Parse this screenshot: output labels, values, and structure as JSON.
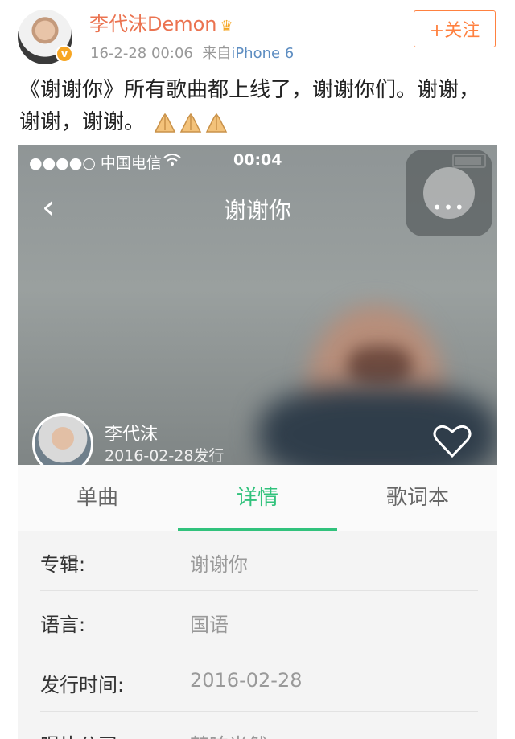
{
  "post": {
    "username": "李代沫Demon",
    "timestamp": "16-2-28 00:06",
    "source_prefix": "来自",
    "source": "iPhone 6",
    "follow_label": "+关注",
    "text": "《谢谢你》所有歌曲都上线了，谢谢你们。谢谢，谢谢，谢谢。",
    "emojis": [
      "praying-hands-icon",
      "praying-hands-icon",
      "praying-hands-icon"
    ],
    "badge_icon": "crown-icon",
    "verified_icon": "verified-v-icon"
  },
  "screenshot": {
    "status": {
      "carrier": "●●●●○ 中国电信",
      "wifi_icon": "wifi-icon",
      "time": "00:04",
      "battery_icon": "battery-icon"
    },
    "nav": {
      "back_icon": "chevron-left-icon",
      "title": "谢谢你",
      "more_icon": "more-dots-icon"
    },
    "artist": {
      "name": "李代沫",
      "release": "2016-02-28发行",
      "like_icon": "heart-outline-icon"
    },
    "tabs": [
      {
        "label": "单曲",
        "active": false
      },
      {
        "label": "详情",
        "active": true
      },
      {
        "label": "歌词本",
        "active": false
      }
    ],
    "details": [
      {
        "label": "专辑:",
        "value": "谢谢你"
      },
      {
        "label": "语言:",
        "value": "国语"
      },
      {
        "label": "发行时间:",
        "value": "2016-02-28"
      },
      {
        "label": "唱片公司:",
        "value": "梵响光然"
      }
    ],
    "colors": {
      "accent_green": "#31c27c",
      "weibo_orange": "#eb7350",
      "follow_orange": "#ff8140",
      "link_blue": "#5d8dc1"
    }
  }
}
